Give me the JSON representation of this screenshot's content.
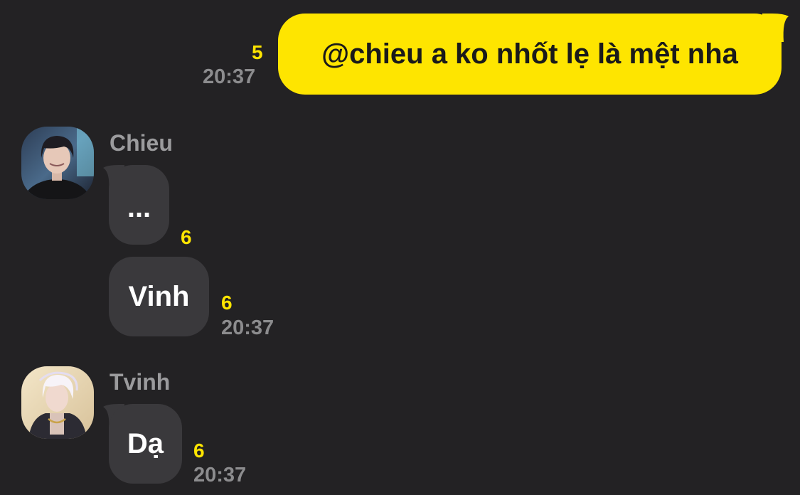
{
  "messages": [
    {
      "direction": "outgoing",
      "text": "@chieu a ko nhốt lẹ là mệt nha",
      "unread_count": "5",
      "time": "20:37"
    },
    {
      "direction": "incoming",
      "sender": "Chieu",
      "bubbles": [
        {
          "text": "...",
          "unread_count": "6"
        },
        {
          "text": "Vinh",
          "unread_count": "6",
          "time": "20:37"
        }
      ]
    },
    {
      "direction": "incoming",
      "sender": "Tvinh",
      "bubbles": [
        {
          "text": "Dạ",
          "unread_count": "6",
          "time": "20:37"
        }
      ]
    }
  ],
  "colors": {
    "background": "#232224",
    "outgoing_bubble": "#fee500",
    "incoming_bubble": "#3a393c",
    "unread_count": "#fee500",
    "timestamp": "#8c8c8e"
  }
}
